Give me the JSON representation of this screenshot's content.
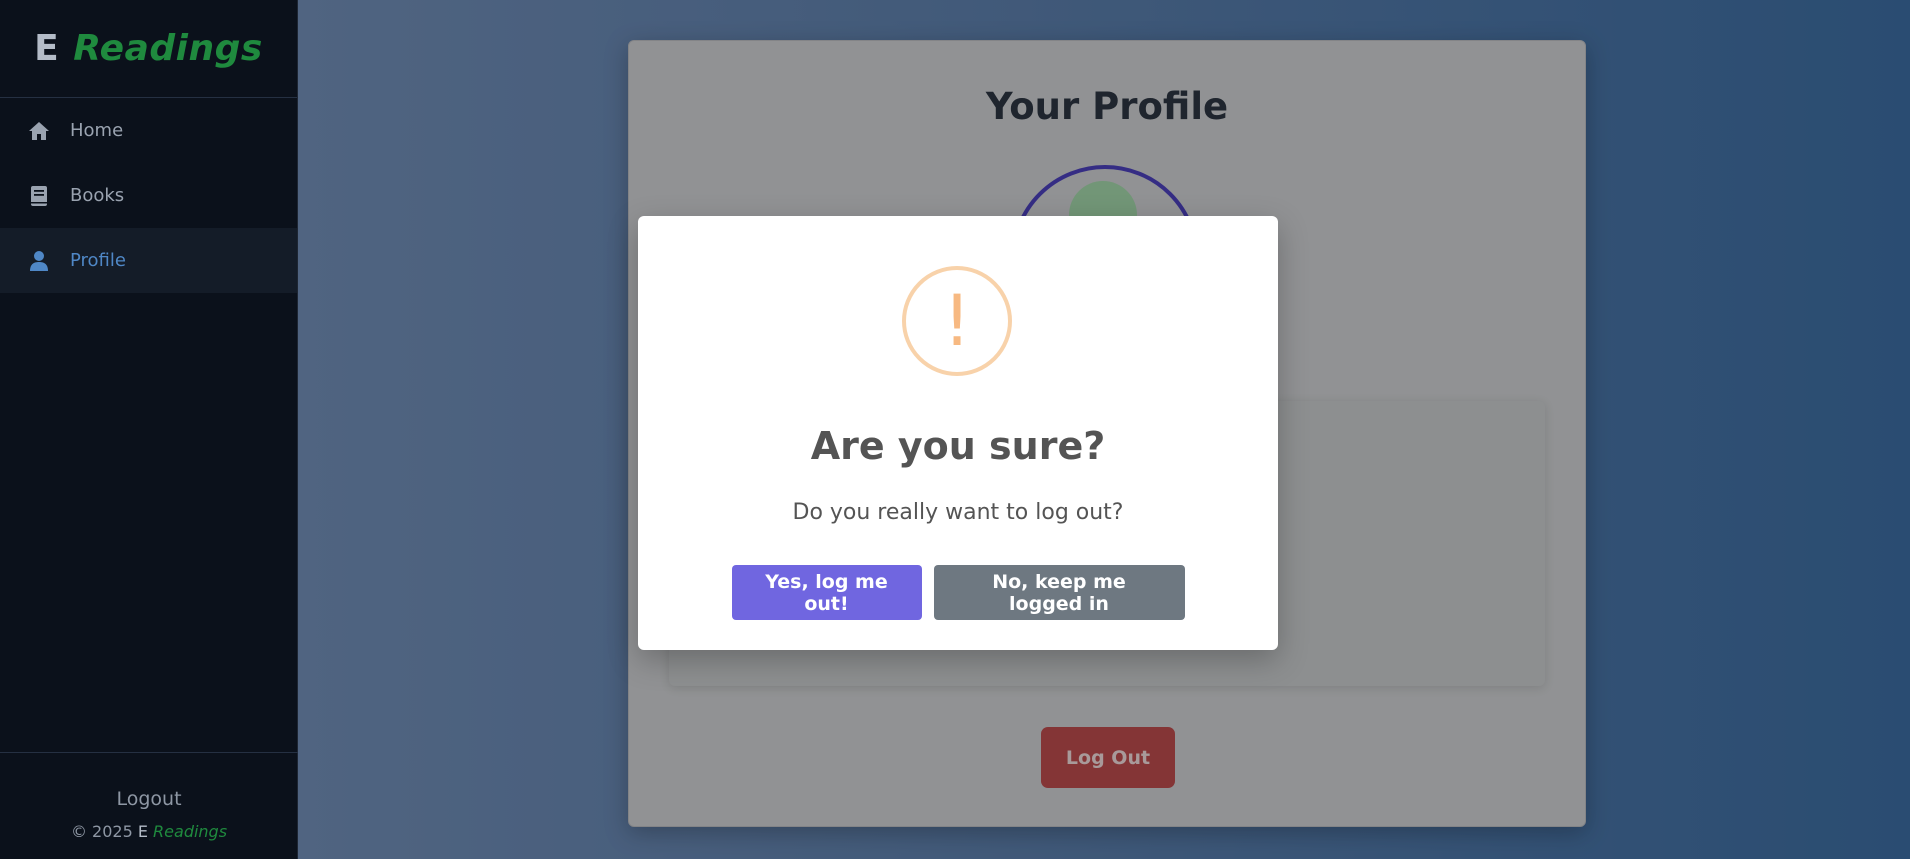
{
  "brand": {
    "prefix": "E",
    "name": "Readings"
  },
  "sidebar": {
    "items": [
      {
        "label": "Home",
        "icon": "home-icon"
      },
      {
        "label": "Books",
        "icon": "book-icon"
      },
      {
        "label": "Profile",
        "icon": "user-icon",
        "active": true
      }
    ],
    "logout_label": "Logout",
    "copyright_prefix": "© 2025",
    "copyright_e": "E",
    "copyright_name": "Readings"
  },
  "profile": {
    "title": "Your Profile",
    "logout_button": "Log Out"
  },
  "modal": {
    "icon": "warning-icon",
    "icon_glyph": "!",
    "title": "Are you sure?",
    "text": "Do you really want to log out?",
    "confirm_label": "Yes, log me out!",
    "cancel_label": "No, keep me logged in"
  },
  "colors": {
    "sidebar_bg": "#0b111b",
    "brand_green": "#1f8a3e",
    "active_blue": "#4f87c6",
    "confirm_purple": "#7066e0",
    "cancel_gray": "#6e7881",
    "logout_red": "#b84a4c",
    "warning_orange": "#f8bb86"
  }
}
